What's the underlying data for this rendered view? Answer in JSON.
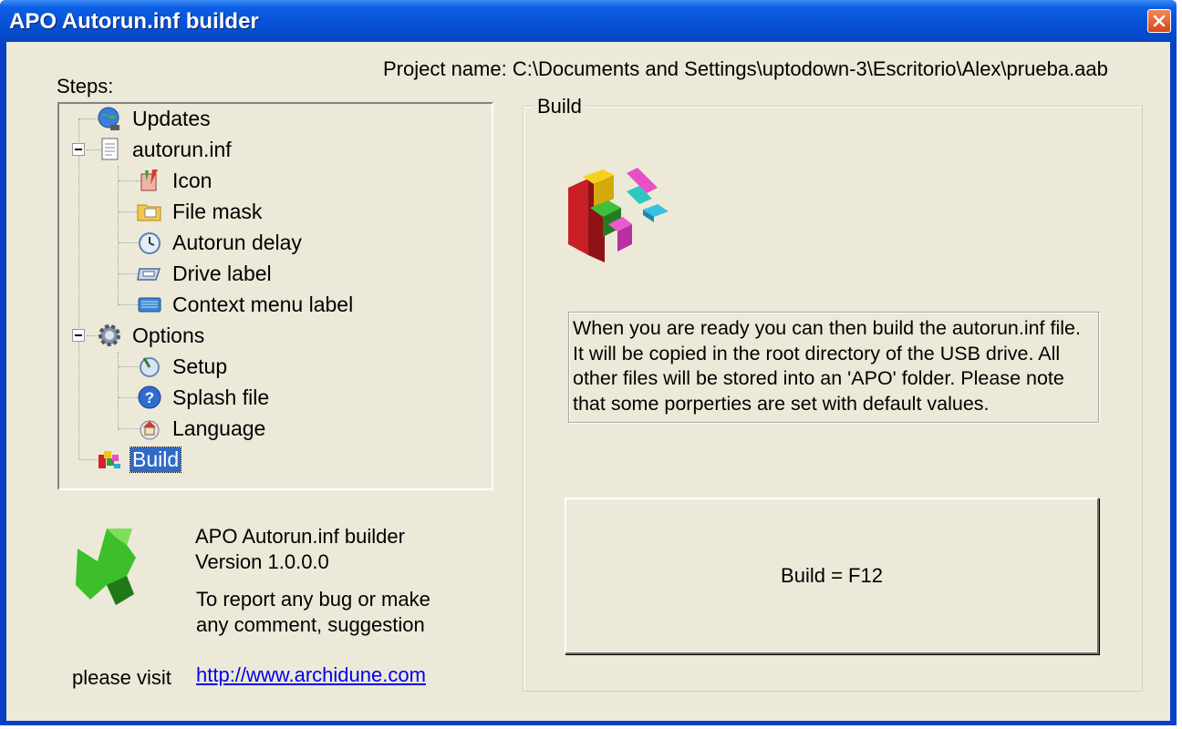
{
  "window": {
    "title": "APO Autorun.inf builder"
  },
  "header": {
    "project_label": "Project name: C:\\Documents and Settings\\uptodown-3\\Escritorio\\Alex\\prueba.aab"
  },
  "sidebar": {
    "steps_label": "Steps:",
    "tree": [
      {
        "label": "Updates",
        "icon": "globe-update-icon"
      },
      {
        "label": "autorun.inf",
        "icon": "document-icon",
        "expanded": true
      },
      {
        "label": "Icon",
        "icon": "paint-icon"
      },
      {
        "label": "File mask",
        "icon": "folder-icon"
      },
      {
        "label": "Autorun delay",
        "icon": "clock-icon"
      },
      {
        "label": "Drive label",
        "icon": "drive-icon"
      },
      {
        "label": "Context menu label",
        "icon": "keyboard-icon"
      },
      {
        "label": "Options",
        "icon": "gear-icon",
        "expanded": true
      },
      {
        "label": "Setup",
        "icon": "setup-icon"
      },
      {
        "label": "Splash file",
        "icon": "help-icon"
      },
      {
        "label": "Language",
        "icon": "home-icon"
      },
      {
        "label": "Build",
        "icon": "blocks-icon",
        "selected": true
      }
    ]
  },
  "about": {
    "app_name": "APO Autorun.inf builder",
    "version": "Version 1.0.0.0",
    "report_line1": "To report any bug or make",
    "report_line2": "any comment, suggestion",
    "visit_label": "please visit",
    "link": "http://www.archidune.com"
  },
  "build_panel": {
    "group_title": "Build",
    "description": "When you are ready you can then build the autorun.inf file. It will be copied in the root directory of the USB drive. All other files will be stored into an 'APO' folder. Please note that some porperties are set with default values.",
    "button_label": "Build = F12"
  },
  "colors": {
    "titlebar": "#0650d6",
    "client_bg": "#ece9d8",
    "selection": "#316ac5",
    "link": "#0000ee"
  }
}
